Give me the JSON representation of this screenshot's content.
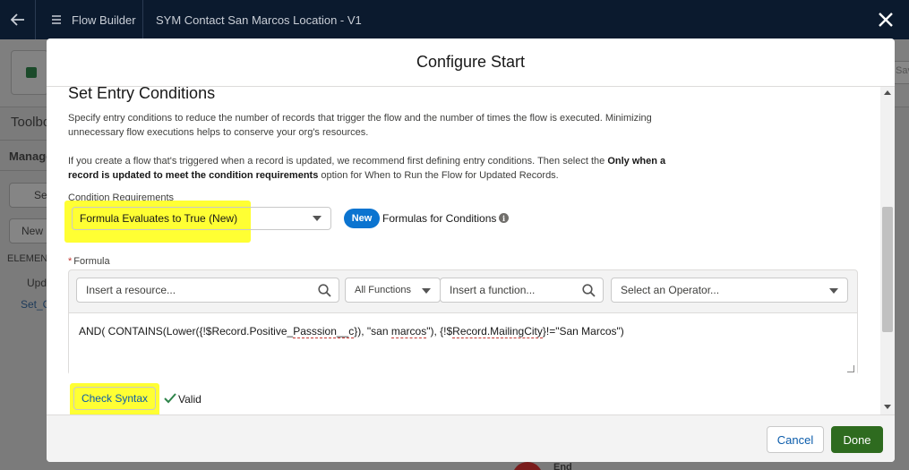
{
  "app": {
    "breadcrumb": "Flow Builder",
    "flow_name": "SYM Contact San Marcos Location - V1"
  },
  "background": {
    "toolbox_label": "Toolbo",
    "manager_tab": "Manage",
    "search_placeholder": "Se",
    "new_button": "New",
    "elements_heading": "ELEMENT",
    "group_label": "Upd",
    "item_label": "Set_C",
    "save_fragment": "Sav",
    "end_label": "End"
  },
  "modal": {
    "title": "Configure Start",
    "section_title": "Set Entry Conditions",
    "description_1": "Specify entry conditions to reduce the number of records that trigger the flow and the number of times the flow is executed. Minimizing unnecessary flow executions helps to conserve your org's resources.",
    "description_2_prefix": "If you create a flow that's triggered when a record is updated, we recommend first defining entry conditions. Then select the ",
    "description_2_bold": "Only when a record is updated to meet the condition requirements",
    "description_2_suffix": " option for When to Run the Flow for Updated Records.",
    "condition_label": "Condition Requirements",
    "condition_value": "Formula Evaluates to True (New)",
    "new_badge": "New",
    "new_badge_text": "Formulas for Conditions",
    "formula_label": "Formula",
    "formula_required_mark": "*",
    "resource_placeholder": "Insert a resource...",
    "functions_select": "All Functions",
    "function_placeholder": "Insert a function...",
    "operator_placeholder": "Select an Operator...",
    "formula_part_1": "AND( CONTAINS(Lower({!$Record.Positive_",
    "formula_err_1": "Passsion__c",
    "formula_part_2": "}), \"san ",
    "formula_err_2": "marcos",
    "formula_part_3": "\"), {!$",
    "formula_err_3": "Record.MailingCity",
    "formula_part_4": "}!=\"San Marcos\")",
    "check_syntax_button": "Check Syntax",
    "valid_text": "Valid"
  },
  "footer": {
    "cancel_label": "Cancel",
    "done_label": "Done"
  },
  "colors": {
    "brand_blue": "#0b74d0",
    "done_green": "#2e6b1f",
    "highlight": "#ffff33",
    "topbar": "#0b1a2e"
  }
}
